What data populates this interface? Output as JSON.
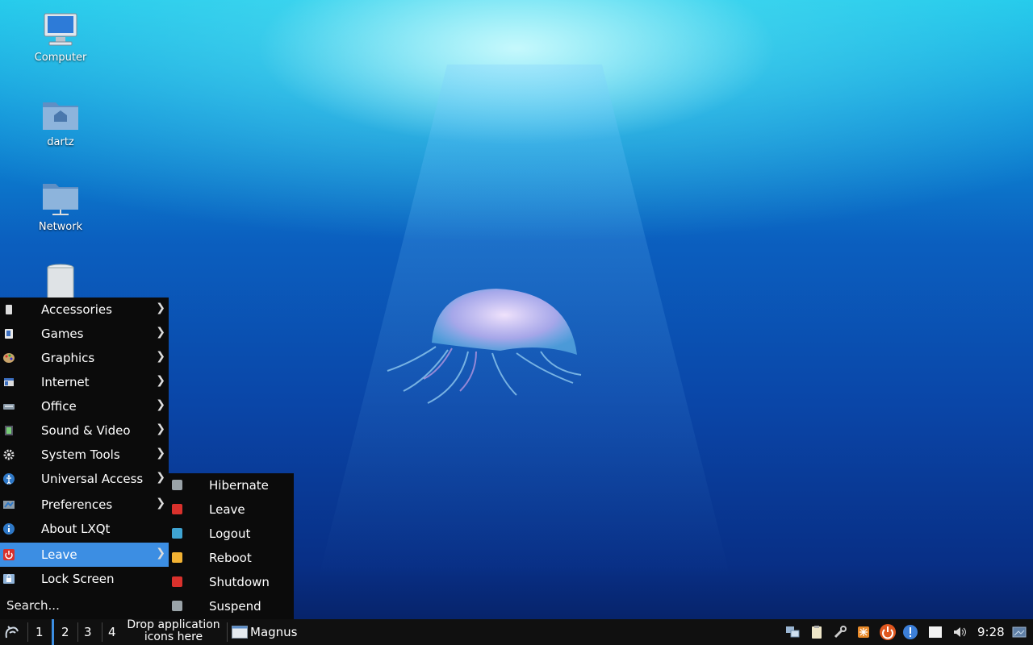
{
  "desktop": {
    "icons": [
      {
        "label": "Computer",
        "icon": "computer-icon"
      },
      {
        "label": "dartz",
        "icon": "home-folder-icon"
      },
      {
        "label": "Network",
        "icon": "network-folder-icon"
      },
      {
        "label": "",
        "icon": "trash-icon"
      }
    ]
  },
  "menu": {
    "items": [
      {
        "label": "Accessories",
        "icon": "accessories-icon",
        "submenu": true
      },
      {
        "label": "Games",
        "icon": "games-icon",
        "submenu": true
      },
      {
        "label": "Graphics",
        "icon": "graphics-icon",
        "submenu": true
      },
      {
        "label": "Internet",
        "icon": "internet-icon",
        "submenu": true
      },
      {
        "label": "Office",
        "icon": "office-icon",
        "submenu": true
      },
      {
        "label": "Sound & Video",
        "icon": "sound-video-icon",
        "submenu": true
      },
      {
        "label": "System Tools",
        "icon": "system-tools-icon",
        "submenu": true
      },
      {
        "label": "Universal Access",
        "icon": "universal-access-icon",
        "submenu": true
      },
      {
        "label": "Preferences",
        "icon": "preferences-icon",
        "submenu": true
      },
      {
        "label": "About LXQt",
        "icon": "about-icon",
        "submenu": false
      },
      {
        "label": "Leave",
        "icon": "leave-icon",
        "submenu": true,
        "active": true
      },
      {
        "label": "Lock Screen",
        "icon": "lock-icon",
        "submenu": false
      }
    ],
    "search_placeholder": "Search...",
    "arrow": "❯"
  },
  "leave_submenu": {
    "items": [
      {
        "label": "Hibernate",
        "icon": "hibernate-icon",
        "color": "#9aa3a8"
      },
      {
        "label": "Leave",
        "icon": "leave-icon",
        "color": "#d9312c"
      },
      {
        "label": "Logout",
        "icon": "logout-icon",
        "color": "#3fa4d2"
      },
      {
        "label": "Reboot",
        "icon": "reboot-icon",
        "color": "#f2b233"
      },
      {
        "label": "Shutdown",
        "icon": "shutdown-icon",
        "color": "#d9312c"
      },
      {
        "label": "Suspend",
        "icon": "suspend-icon",
        "color": "#9aa3a8"
      }
    ]
  },
  "taskbar": {
    "workspaces": [
      "1",
      "2",
      "3",
      "4"
    ],
    "drop_hint_line1": "Drop application",
    "drop_hint_line2": "icons here",
    "task_label": "Magnus",
    "clock": "9:28"
  },
  "colors": {
    "accent": "#3c8ee3",
    "menu_bg": "#0b0b0b",
    "taskbar_bg": "#101010"
  }
}
